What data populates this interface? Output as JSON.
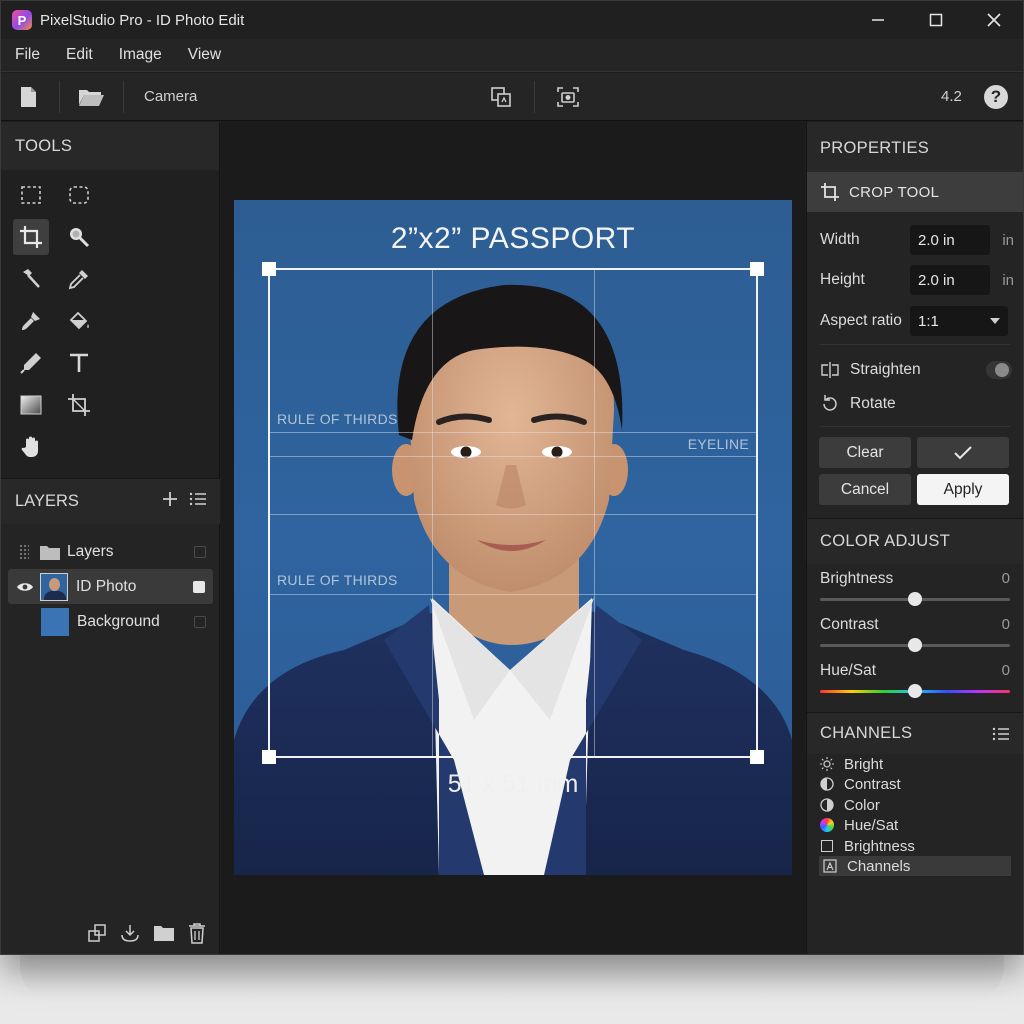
{
  "window": {
    "app_initial": "P",
    "title": "PixelStudio Pro - ID Photo Edit"
  },
  "menu": [
    "File",
    "Edit",
    "Image",
    "View"
  ],
  "toolbar": {
    "camera_label": "Camera",
    "version": "4.2",
    "help": "?"
  },
  "tools_panel": {
    "title": "TOOLS"
  },
  "layers_panel": {
    "title": "LAYERS",
    "items": [
      {
        "label": "Layers",
        "type": "group"
      },
      {
        "label": "ID Photo",
        "type": "image",
        "selected": true,
        "visible": true
      },
      {
        "label": "Background",
        "type": "fill",
        "color": "#3a74b4"
      }
    ]
  },
  "canvas": {
    "photo_title": "2”x2” PASSPORT",
    "guide_thirds": "RULE OF THIRDS",
    "guide_eyeline": "EYELINE",
    "dimensions": "51 x 51 mm",
    "background_color": "#2f64a0"
  },
  "properties": {
    "title": "PROPERTIES",
    "tool_name": "CROP TOOL",
    "width_label": "Width",
    "width_value": "2.0 in",
    "width_unit": "in",
    "height_label": "Height",
    "height_value": "2.0 in",
    "height_unit": "in",
    "aspect_label": "Aspect ratio",
    "aspect_value": "1:1",
    "straighten_label": "Straighten",
    "rotate_label": "Rotate",
    "clear_label": "Clear",
    "confirm_icon": "✓",
    "cancel_label": "Cancel",
    "apply_label": "Apply"
  },
  "color_adjust": {
    "title": "COLOR ADJUST",
    "sliders": [
      {
        "label": "Brightness",
        "value": "0",
        "level": 0.5
      },
      {
        "label": "Contrast",
        "value": "0",
        "level": 0.5
      },
      {
        "label": "Hue/Sat",
        "value": "0",
        "level": 0.5
      }
    ]
  },
  "channels": {
    "title": "CHANNELS",
    "items": [
      "Bright",
      "Contrast",
      "Color",
      "Hue/Sat",
      "Brightness",
      "Channels"
    ]
  }
}
